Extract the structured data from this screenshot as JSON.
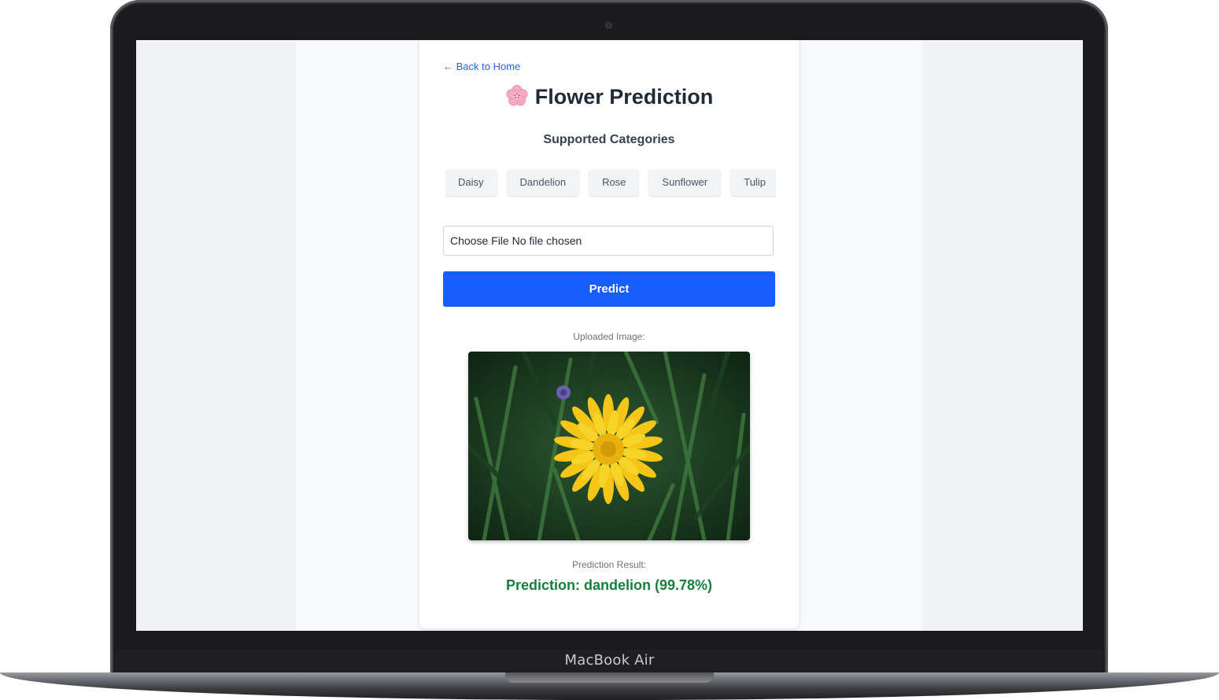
{
  "device": {
    "brand_label": "MacBook Air"
  },
  "nav": {
    "back_link": "← Back to Home"
  },
  "header": {
    "title": "Flower Prediction",
    "title_icon": "cherry-blossom-icon"
  },
  "categories": {
    "heading": "Supported Categories",
    "items": [
      "Daisy",
      "Dandelion",
      "Rose",
      "Sunflower",
      "Tulip"
    ]
  },
  "upload": {
    "file_input_text": "Choose File No file chosen",
    "predict_label": "Predict",
    "uploaded_label": "Uploaded Image:"
  },
  "result": {
    "label": "Prediction Result:",
    "text": "Prediction: dandelion (99.78%)"
  },
  "colors": {
    "accent": "#165dfb",
    "link": "#2563eb",
    "success": "#15803d"
  }
}
